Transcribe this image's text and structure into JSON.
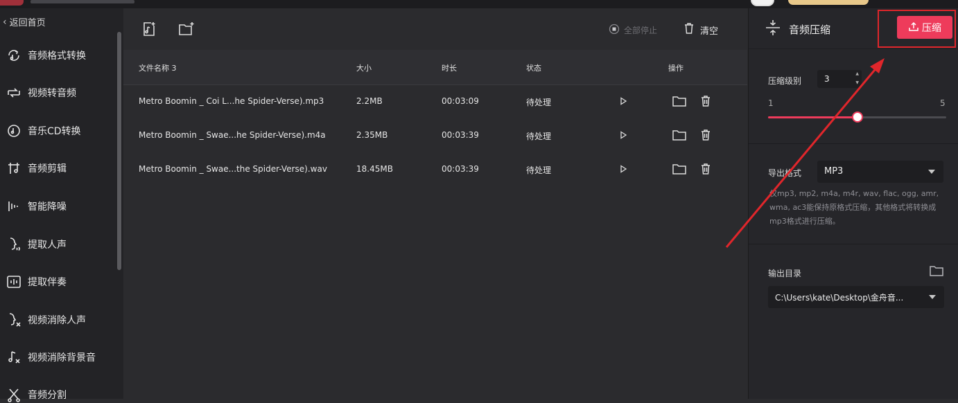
{
  "titlebar": {},
  "sidebar": {
    "back_label": "返回首页",
    "items": [
      {
        "label": "音频格式转换",
        "icon": "audio-convert-icon"
      },
      {
        "label": "视频转音频",
        "icon": "video-to-audio-icon"
      },
      {
        "label": "音乐CD转换",
        "icon": "cd-icon"
      },
      {
        "label": "音频剪辑",
        "icon": "audio-cut-icon"
      },
      {
        "label": "智能降噪",
        "icon": "noise-reduction-icon"
      },
      {
        "label": "提取人声",
        "icon": "vocal-extract-icon"
      },
      {
        "label": "提取伴奏",
        "icon": "accompaniment-icon"
      },
      {
        "label": "视频消除人声",
        "icon": "remove-vocal-icon"
      },
      {
        "label": "视频消除背景音",
        "icon": "remove-bg-icon"
      },
      {
        "label": "音频分割",
        "icon": "split-icon"
      }
    ]
  },
  "toolbar": {
    "add_file_icon": "add-music-file-icon",
    "add_folder_icon": "add-folder-icon",
    "stop_all_label": "全部停止",
    "clear_label": "清空"
  },
  "table": {
    "headers": {
      "name": "文件名称 3",
      "size": "大小",
      "duration": "时长",
      "status": "状态",
      "actions": "操作"
    },
    "rows": [
      {
        "name": "Metro Boomin _ Coi L...he Spider-Verse).mp3",
        "size": "2.2MB",
        "duration": "00:03:09",
        "status": "待处理"
      },
      {
        "name": "Metro Boomin _ Swae...he Spider-Verse).m4a",
        "size": "2.35MB",
        "duration": "00:03:39",
        "status": "待处理"
      },
      {
        "name": "Metro Boomin _ Swae...the Spider-Verse).wav",
        "size": "18.45MB",
        "duration": "00:03:39",
        "status": "待处理"
      }
    ]
  },
  "panel": {
    "title": "音频压缩",
    "compress_button": "压缩",
    "level_label": "压缩级别",
    "level_value": "3",
    "slider_min": "1",
    "slider_max": "5",
    "slider_value": 3,
    "format_label": "导出格式",
    "format_value": "MP3",
    "format_note": "仅mp3, mp2, m4a, m4r, wav, flac, ogg, amr, wma, ac3能保持原格式压缩，其他格式将转换成mp3格式进行压缩。",
    "output_label": "输出目录",
    "output_path": "C:\\Users\\kate\\Desktop\\金舟音..."
  },
  "colors": {
    "accent": "#ee3b5b",
    "annotation": "#e0262b",
    "sidebar_bg": "#232326",
    "main_bg": "#2b2b2e"
  }
}
